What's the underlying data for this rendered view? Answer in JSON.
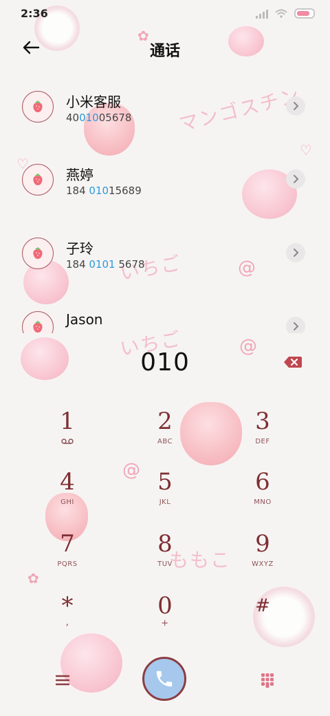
{
  "status_bar": {
    "time": "2:36"
  },
  "header": {
    "title": "通话"
  },
  "contacts": [
    {
      "name": "小米客服",
      "number_parts": [
        "40",
        "010",
        "05678"
      ]
    },
    {
      "name": "燕婷",
      "number_parts": [
        "184 ",
        "010",
        "15689"
      ]
    },
    {
      "name": "子玲",
      "number_parts": [
        "184 ",
        "0101",
        " 5678"
      ]
    },
    {
      "name": "Jason",
      "number_parts": [
        "",
        "",
        ""
      ]
    }
  ],
  "dialer": {
    "input": "010"
  },
  "keypad": [
    {
      "digit": "1",
      "letters": ""
    },
    {
      "digit": "2",
      "letters": "ABC"
    },
    {
      "digit": "3",
      "letters": "DEF"
    },
    {
      "digit": "4",
      "letters": "GHI"
    },
    {
      "digit": "5",
      "letters": "JKL"
    },
    {
      "digit": "6",
      "letters": "MNO"
    },
    {
      "digit": "7",
      "letters": "PQRS"
    },
    {
      "digit": "8",
      "letters": "TUV"
    },
    {
      "digit": "9",
      "letters": "WXYZ"
    },
    {
      "digit": "*",
      "letters": ","
    },
    {
      "digit": "0",
      "letters": "+"
    },
    {
      "digit": "#",
      "letters": ""
    }
  ],
  "decor_text": [
    "マンゴスチン",
    "いちご",
    "いちご",
    "ももこ"
  ],
  "icons": {
    "back": "arrow-left-icon",
    "contact_avatar": "strawberry-icon",
    "row_detail": "chevron-right-icon",
    "backspace": "backspace-icon",
    "voicemail": "voicemail-icon",
    "menu": "hamburger-menu-icon",
    "call": "phone-icon",
    "keypad_toggle": "dialpad-grid-icon"
  },
  "colors": {
    "accent_digit": "#7d2f33",
    "number_highlight": "#2b9bd9",
    "call_button": "#a6c8ec",
    "backspace": "#c0474f"
  }
}
